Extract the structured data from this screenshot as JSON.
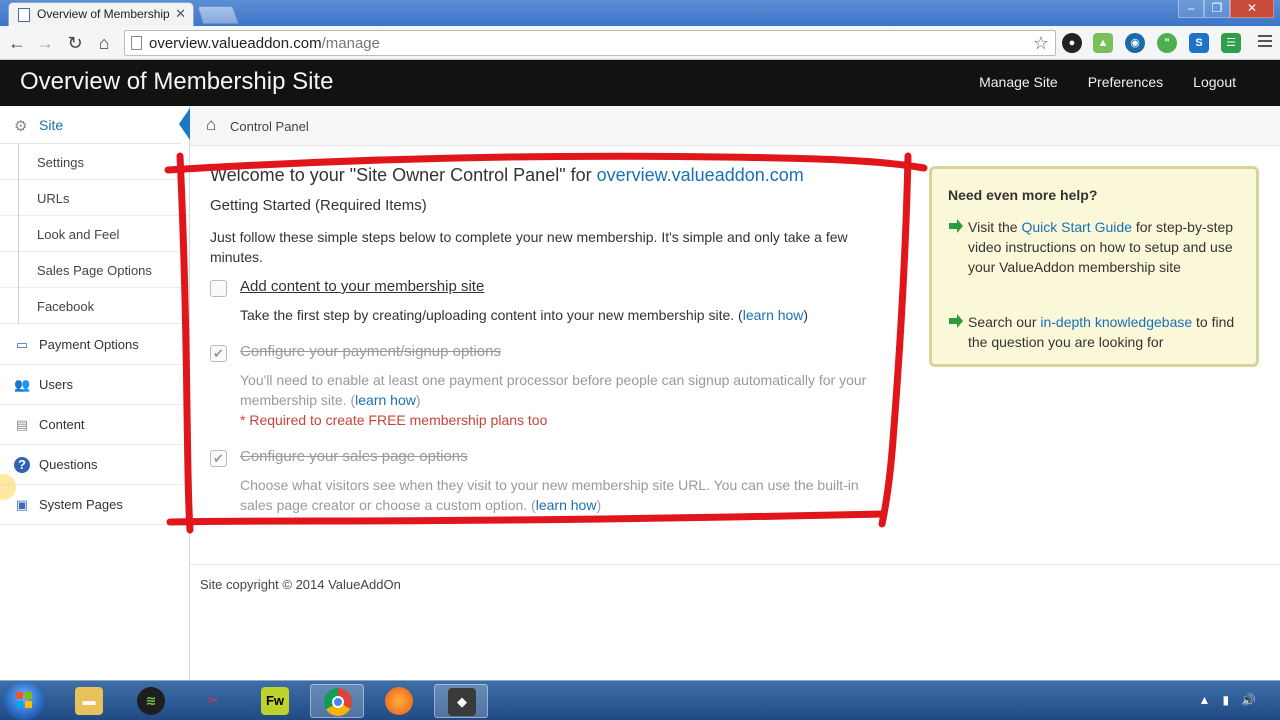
{
  "browser": {
    "tab_title": "Overview of Membership",
    "url_domain": "overview.valueaddon.com",
    "url_path": "/manage",
    "extension_icons": [
      "camera-icon",
      "image-icon",
      "globe-icon",
      "hangouts-icon",
      "s-icon",
      "grid-icon"
    ]
  },
  "header": {
    "title": "Overview of Membership Site",
    "nav": [
      "Manage Site",
      "Preferences",
      "Logout"
    ]
  },
  "sidebar": {
    "active": "Site",
    "sub_items": [
      "Settings",
      "URLs",
      "Look and Feel",
      "Sales Page Options",
      "Facebook"
    ],
    "items": [
      "Payment Options",
      "Users",
      "Content",
      "Questions",
      "System Pages"
    ]
  },
  "breadcrumb": "Control Panel",
  "main": {
    "welcome_prefix": "Welcome to your \"Site Owner Control Panel\" for",
    "welcome_domain": "overview.valueaddon.com",
    "getting_started": "Getting Started (Required Items)",
    "intro": "Just follow these simple steps below to complete your new membership. It's simple and only take a few minutes.",
    "learn_how": "learn how",
    "steps": [
      {
        "title": "Add content to your membership site",
        "desc": "Take the first step by creating/uploading content into your new membership site.",
        "done": false
      },
      {
        "title": "Configure your payment/signup options",
        "desc": "You'll need to enable at least one payment processor before people can signup automatically for your membership site.",
        "note": "* Required to create FREE membership plans too",
        "done": true
      },
      {
        "title": "Configure your sales page options",
        "desc": "Choose what visitors see when they visit to your new membership site URL. You can use the built-in sales page creator or choose a custom option.",
        "done": true
      }
    ],
    "copyright": "Site copyright © 2014 ValueAddOn"
  },
  "help": {
    "title": "Need even more help?",
    "item1_pre": "Visit the",
    "item1_link": "Quick Start Guide",
    "item1_post": "for step-by-step video instructions on how to setup and use your ValueAddon membership site",
    "item2_pre": "Search our",
    "item2_link": "in-depth knowledgebase",
    "item2_post": "to find the question you are looking for"
  },
  "colors": {
    "link": "#1a6fb7",
    "header_bg": "#121212",
    "annotation": "#e0161b",
    "help_bg": "#fbf8da",
    "required": "#c9433a"
  }
}
